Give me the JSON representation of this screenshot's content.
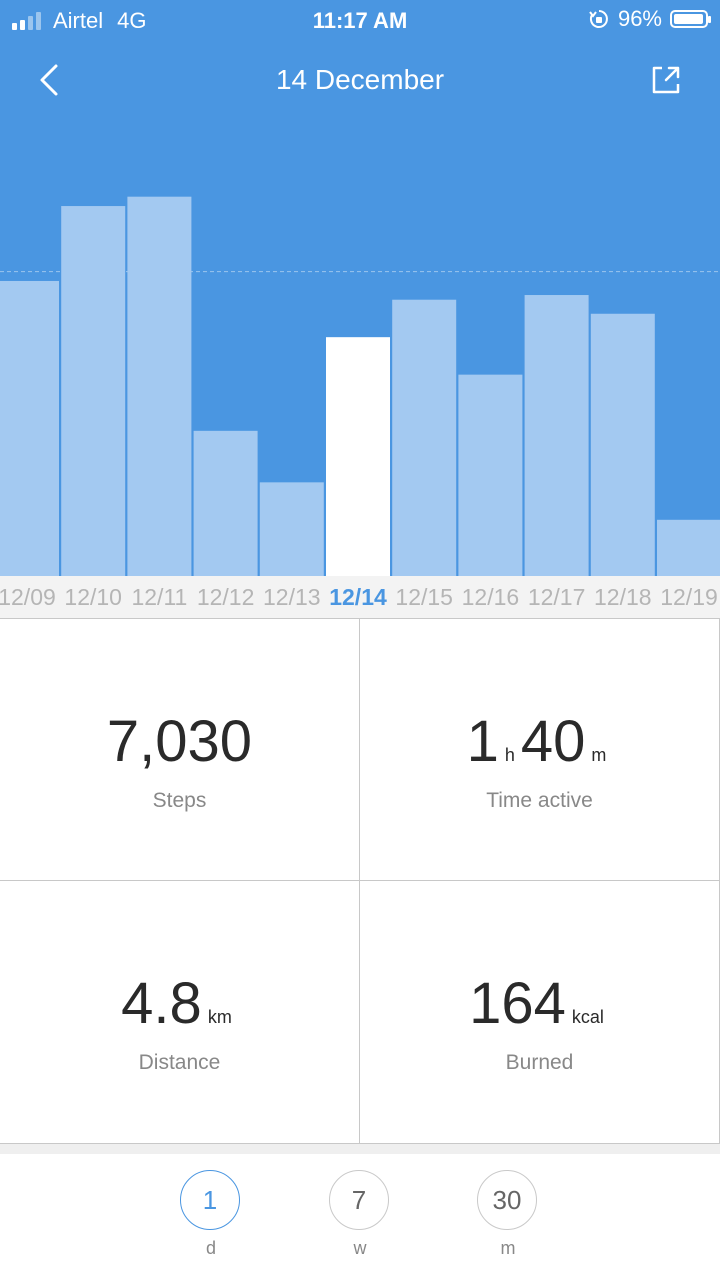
{
  "status_bar": {
    "carrier": "Airtel",
    "network": "4G",
    "time": "11:17 AM",
    "battery": "96%",
    "battery_level": 0.96
  },
  "header": {
    "title": "14 December"
  },
  "chart_data": {
    "type": "bar",
    "categories": [
      "12/09",
      "12/10",
      "12/11",
      "12/12",
      "12/13",
      "12/14",
      "12/15",
      "12/16",
      "12/17",
      "12/18",
      "12/19"
    ],
    "values": [
      6300,
      7900,
      8100,
      3100,
      2000,
      5100,
      5900,
      4300,
      6000,
      5600,
      1200
    ],
    "selected": "12/14",
    "ylim": [
      0,
      12300
    ],
    "goal": 6500,
    "colors": {
      "background": "#4a96e1",
      "bar": "#a3c9f1",
      "selected_bar": "#ffffff",
      "selected_label": "#4a96e1",
      "label": "#b5b5b5"
    }
  },
  "stats": {
    "steps": {
      "value": "7,030",
      "label": "Steps"
    },
    "time_active": {
      "hours": "1",
      "hours_unit": "h",
      "minutes": "40",
      "minutes_unit": "m",
      "label": "Time active"
    },
    "distance": {
      "value": "4.8",
      "unit": "km",
      "label": "Distance"
    },
    "burned": {
      "value": "164",
      "unit": "kcal",
      "label": "Burned"
    }
  },
  "ranges": [
    {
      "value": "1",
      "label": "d",
      "active": true
    },
    {
      "value": "7",
      "label": "w",
      "active": false
    },
    {
      "value": "30",
      "label": "m",
      "active": false
    }
  ]
}
